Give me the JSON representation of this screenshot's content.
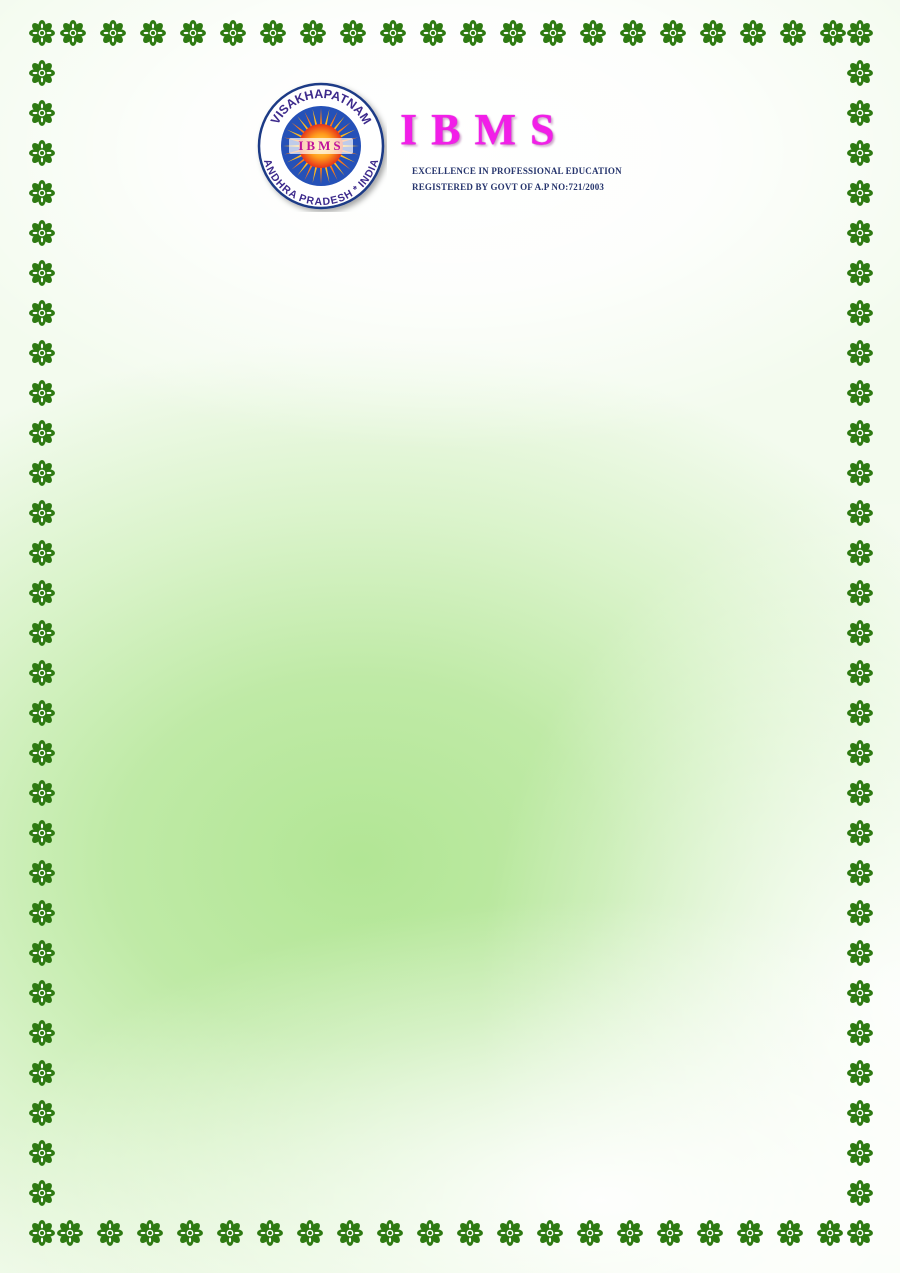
{
  "header": {
    "seal": {
      "top_arc_text": "VISAKHAPATNAM",
      "bottom_arc_text": "ANDHRA PRADESH * INDIA",
      "center_text": "IBMS"
    },
    "wordmark": "IBMS",
    "tagline_1": "EXCELLENCE IN PROFESSIONAL EDUCATION",
    "tagline_2": "REGISTERED BY GOVT OF A.P NO:721/2003"
  },
  "colors": {
    "border_ornament": "#2e7a12",
    "wordmark": "#f21ee8",
    "tagline": "#26356d",
    "seal_ring_text": "#3d2a8c",
    "page_green": "#b2e695"
  },
  "icons": {
    "border_ornament": "flower-ornament-icon"
  }
}
